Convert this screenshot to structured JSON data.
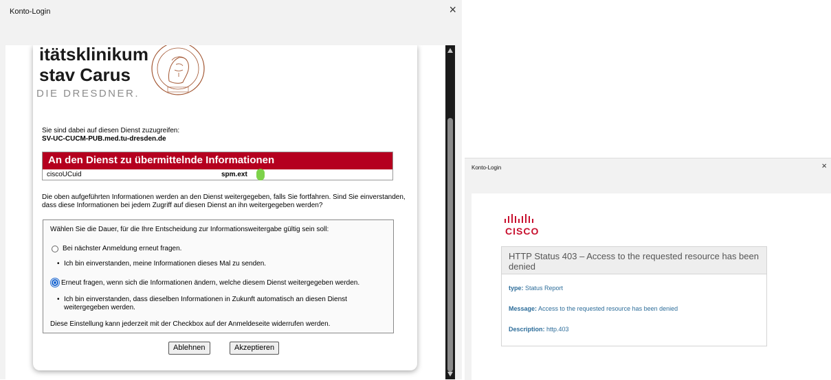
{
  "left_dialog": {
    "title": "Konto-Login",
    "close": "×",
    "logo": {
      "line1": "itätsklinikum",
      "line2": "stav Carus",
      "line3": "DIE DRESDNER."
    },
    "intro_line": "Sie sind dabei auf diesen Dienst zuzugreifen:",
    "service_name": "SV-UC-CUCM-PUB.med.tu-dresden.de",
    "info_header": "An den Dienst zu übermittelnde Informationen",
    "info_key": "ciscoUCuid",
    "info_value": "spm.ext",
    "description": "Die oben aufgeführten Informationen werden an den Dienst weitergegeben, falls Sie fortfahren. Sind Sie einverstanden, dass diese Informationen bei jedem Zugriff auf diesen Dienst an ihn weitergegeben werden?",
    "duration_prompt": "Wählen Sie die Dauer, für die Ihre Entscheidung zur Informationsweitergabe gültig sein soll:",
    "option1": "Bei nächster Anmeldung erneut fragen.",
    "option1_bullet": "Ich bin einverstanden, meine Informationen dieses Mal zu senden.",
    "option2": "Erneut fragen, wenn sich die Informationen ändern, welche diesem Dienst weitergegeben werden.",
    "option2_bullet": "Ich bin einverstanden, dass dieselben Informationen in Zukunft automatisch an diesen Dienst weitergegeben werden.",
    "revoke_note": "Diese Einstellung kann jederzeit mit der Checkbox auf der Anmeldeseite widerrufen werden.",
    "reject_button": "Ablehnen",
    "accept_button": "Akzeptieren",
    "selected_option": 2
  },
  "right_dialog": {
    "title": "Konto-Login",
    "close": "×",
    "brand": "CISCO",
    "error_title": "HTTP Status 403 – Access to the requested resource has been denied",
    "type_label": "type:",
    "type_value": "Status Report",
    "message_label": "Message:",
    "message_value": "Access to the requested resource has been denied",
    "description_label": "Description:",
    "description_value": "http.403"
  },
  "colors": {
    "header_red": "#b5001f",
    "cisco_red": "#c8102e",
    "cisco_blue": "#049fd9",
    "link_blue": "#2d6d9a",
    "redaction_green": "#7dd24a"
  }
}
